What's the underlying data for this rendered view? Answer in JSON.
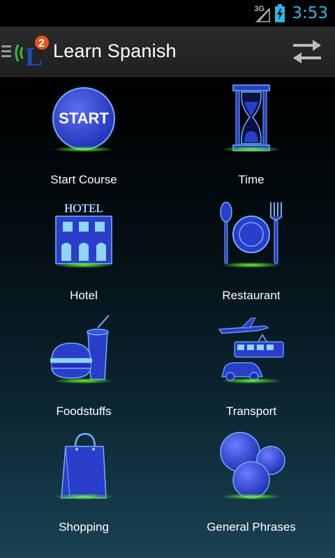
{
  "status_bar": {
    "network": "3G",
    "time": "3:53"
  },
  "action_bar": {
    "title": "Learn Spanish",
    "logo_text": "L",
    "logo_badge": "2"
  },
  "tiles": [
    {
      "label": "Start Course",
      "icon": "start-button-icon",
      "icon_text": "START"
    },
    {
      "label": "Time",
      "icon": "hourglass-icon"
    },
    {
      "label": "Hotel",
      "icon": "hotel-icon",
      "icon_text": "HOTEL"
    },
    {
      "label": "Restaurant",
      "icon": "plate-cutlery-icon"
    },
    {
      "label": "Foodstuffs",
      "icon": "burger-drink-icon"
    },
    {
      "label": "Transport",
      "icon": "vehicles-icon"
    },
    {
      "label": "Shopping",
      "icon": "shopping-bag-icon"
    },
    {
      "label": "General Phrases",
      "icon": "bubbles-icon"
    }
  ],
  "colors": {
    "accent": "#33b5e5",
    "icon_blue": "#2a3ec9",
    "icon_outline": "#4fa9ff",
    "glow": "#6cf23a"
  }
}
